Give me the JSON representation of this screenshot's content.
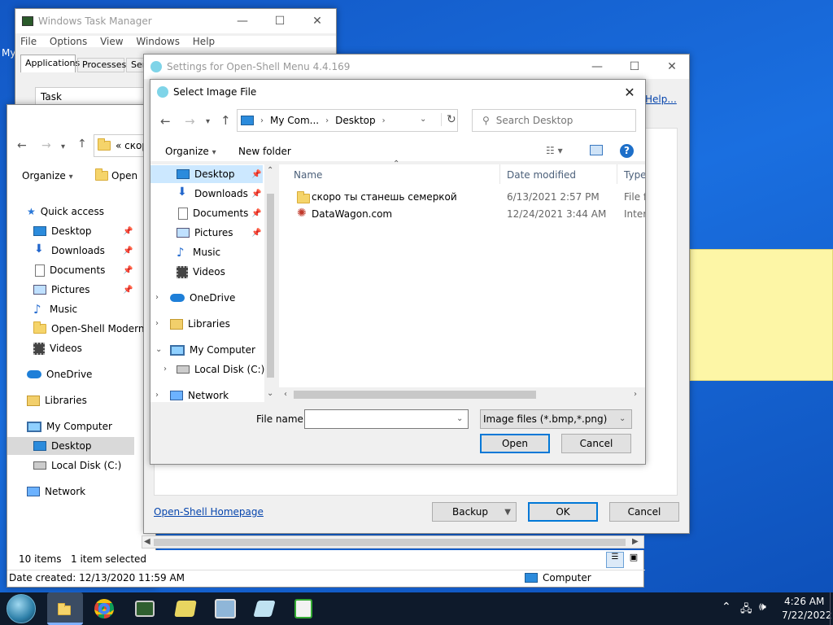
{
  "desktop": {
    "sticky_note": ""
  },
  "task_manager": {
    "title": "Windows Task Manager",
    "menu": [
      "File",
      "Options",
      "View",
      "Windows",
      "Help"
    ],
    "tabs": [
      "Applications",
      "Processes",
      "Ser"
    ],
    "column_task": "Task"
  },
  "explorer": {
    "breadcrumb": "« скор",
    "toolbar": {
      "organize": "Organize",
      "open": "Open"
    },
    "nav": {
      "quick_access": "Quick access",
      "items": [
        "Desktop",
        "Downloads",
        "Documents",
        "Pictures",
        "Music",
        "Open-Shell Modern",
        "Videos"
      ],
      "onedrive": "OneDrive",
      "libraries": "Libraries",
      "my_computer": "My Computer",
      "desktop": "Desktop",
      "local_disk": "Local Disk (C:)",
      "network": "Network"
    },
    "status": {
      "items": "10 items",
      "selected": "1 item selected",
      "date_created": "Date created: 12/13/2020 11:59 AM",
      "computer": "Computer"
    }
  },
  "settings": {
    "title": "Settings for Open-Shell Menu 4.4.169",
    "help_link": "Help...",
    "homepage_link": "Open-Shell Homepage",
    "backup_button": "Backup",
    "ok_button": "OK",
    "cancel_button": "Cancel"
  },
  "dialog": {
    "title": "Select Image File",
    "address": {
      "root": "My Com...",
      "current": "Desktop"
    },
    "search_placeholder": "Search Desktop",
    "toolbar": {
      "organize": "Organize",
      "new_folder": "New folder"
    },
    "nav": {
      "items": [
        "Desktop",
        "Downloads",
        "Documents",
        "Pictures",
        "Music",
        "Videos"
      ],
      "onedrive": "OneDrive",
      "libraries": "Libraries",
      "my_computer": "My Computer",
      "local_disk": "Local Disk (C:)",
      "network": "Network"
    },
    "columns": {
      "name": "Name",
      "date": "Date modified",
      "type": "Type"
    },
    "files": [
      {
        "name": "скоро ты станешь семеркой",
        "date": "6/13/2021 2:57 PM",
        "type": "File fo"
      },
      {
        "name": "DataWagon.com",
        "date": "12/24/2021 3:44 AM",
        "type": "Intern"
      }
    ],
    "file_name_label": "File name:",
    "file_name_value": "",
    "file_type": "Image files (*.bmp,*.png)",
    "open_button": "Open",
    "cancel_button": "Cancel"
  },
  "taskbar": {
    "time": "4:26 AM",
    "date": "7/22/2022"
  }
}
